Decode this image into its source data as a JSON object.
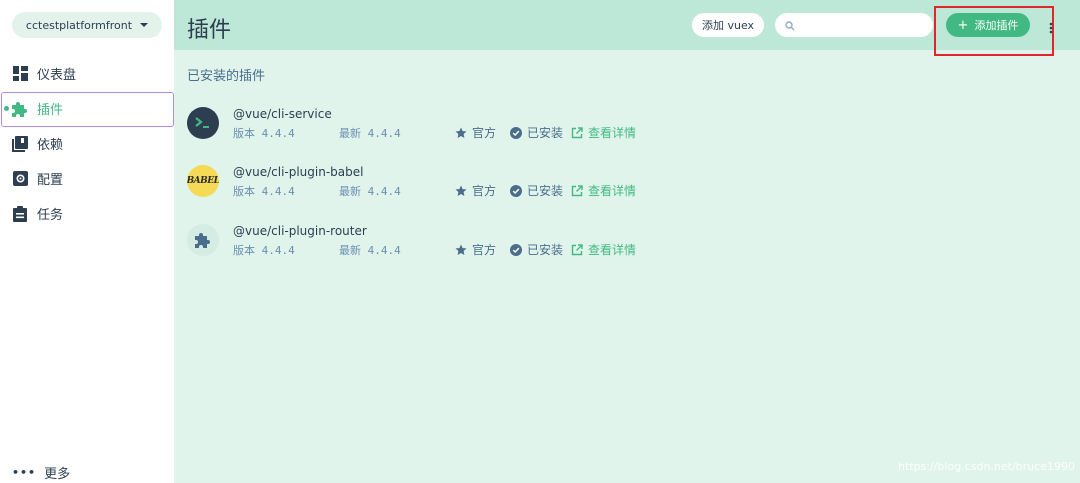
{
  "sidebar": {
    "project": "cctestplatformfront",
    "items": [
      {
        "label": "仪表盘",
        "icon": "dashboard-icon"
      },
      {
        "label": "插件",
        "icon": "puzzle-icon"
      },
      {
        "label": "依赖",
        "icon": "library-icon"
      },
      {
        "label": "配置",
        "icon": "settings-icon"
      },
      {
        "label": "任务",
        "icon": "clipboard-icon"
      }
    ],
    "more_label": "更多"
  },
  "header": {
    "title": "插件",
    "add_vuex_label": "添加 vuex",
    "search_placeholder": "",
    "add_plugin_label": "添加插件"
  },
  "main": {
    "section_title": "已安装的插件",
    "plugins": [
      {
        "name": "@vue/cli-service",
        "version": "版本 4.4.4",
        "latest": "最新 4.4.4",
        "official": "官方",
        "installed": "已安装",
        "details": "查看详情",
        "avatar": "vue-cli-service-logo"
      },
      {
        "name": "@vue/cli-plugin-babel",
        "version": "版本 4.4.4",
        "latest": "最新 4.4.4",
        "official": "官方",
        "installed": "已安装",
        "details": "查看详情",
        "avatar": "babel-logo",
        "avatar_text": "BABEL"
      },
      {
        "name": "@vue/cli-plugin-router",
        "version": "版本 4.4.4",
        "latest": "最新 4.4.4",
        "official": "官方",
        "installed": "已安装",
        "details": "查看详情",
        "avatar": "puzzle-icon"
      }
    ]
  },
  "watermark": "https://blog.csdn.net/bruce1990",
  "colors": {
    "accent": "#42b983",
    "header_bg": "#bde7d6",
    "main_bg": "#e1f4ec",
    "highlight": "#e0262a"
  }
}
